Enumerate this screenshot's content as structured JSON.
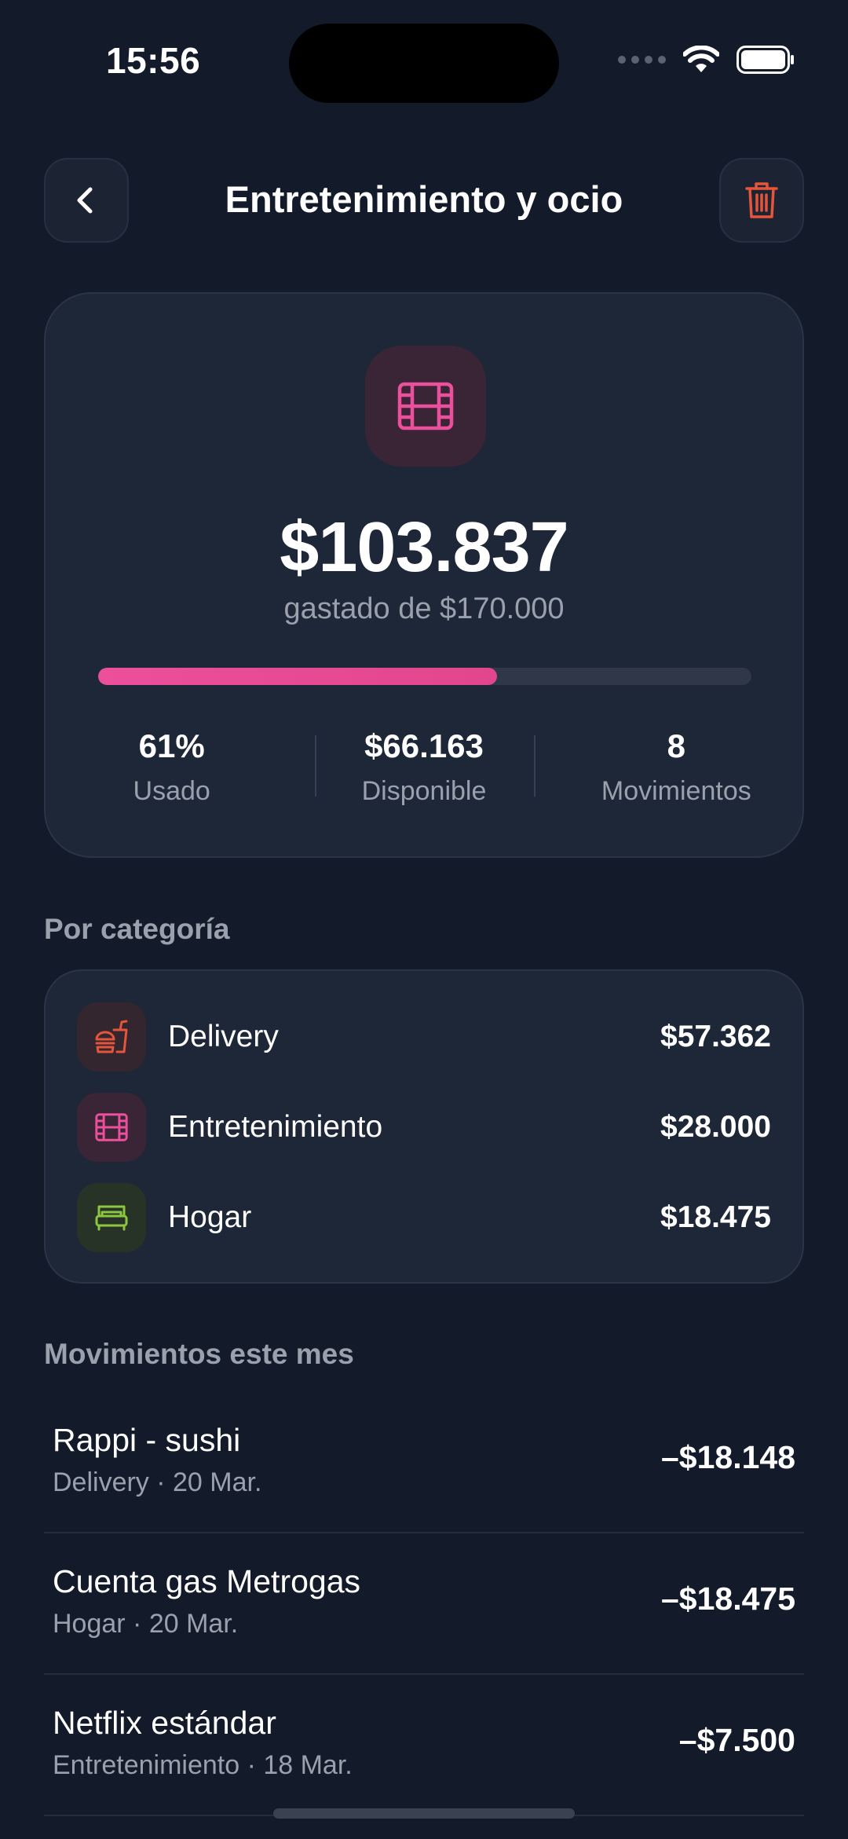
{
  "status_bar": {
    "time": "15:56"
  },
  "header": {
    "title": "Entretenimiento y ocio"
  },
  "summary": {
    "spent": "$103.837",
    "subtitle": "gastado de $170.000",
    "progress_fraction": 0.61,
    "stats": [
      {
        "value": "61%",
        "label": "Usado"
      },
      {
        "value": "$66.163",
        "label": "Disponible"
      },
      {
        "value": "8",
        "label": "Movimientos"
      }
    ]
  },
  "categories_section": {
    "title": "Por categoría",
    "items": [
      {
        "name": "Delivery",
        "amount": "$57.362",
        "icon": "fastfood-icon",
        "color": "#e5553b"
      },
      {
        "name": "Entretenimiento",
        "amount": "$28.000",
        "icon": "film-icon",
        "color": "#ec4f9c"
      },
      {
        "name": "Hogar",
        "amount": "$18.475",
        "icon": "bed-icon",
        "color": "#8cc63f"
      }
    ]
  },
  "movements_section": {
    "title": "Movimientos este mes",
    "items": [
      {
        "title": "Rappi - sushi",
        "subtitle": "Delivery · 20 Mar.",
        "amount": "–$18.148"
      },
      {
        "title": "Cuenta gas Metrogas",
        "subtitle": "Hogar · 20 Mar.",
        "amount": "–$18.475"
      },
      {
        "title": "Netflix estándar",
        "subtitle": "Entretenimiento · 18 Mar.",
        "amount": "–$7.500"
      }
    ]
  },
  "colors": {
    "background": "#131a29",
    "card": "#1e2738",
    "accent_pink": "#ec4f9c",
    "danger": "#e5553b",
    "muted_text": "#9aa1ad"
  }
}
